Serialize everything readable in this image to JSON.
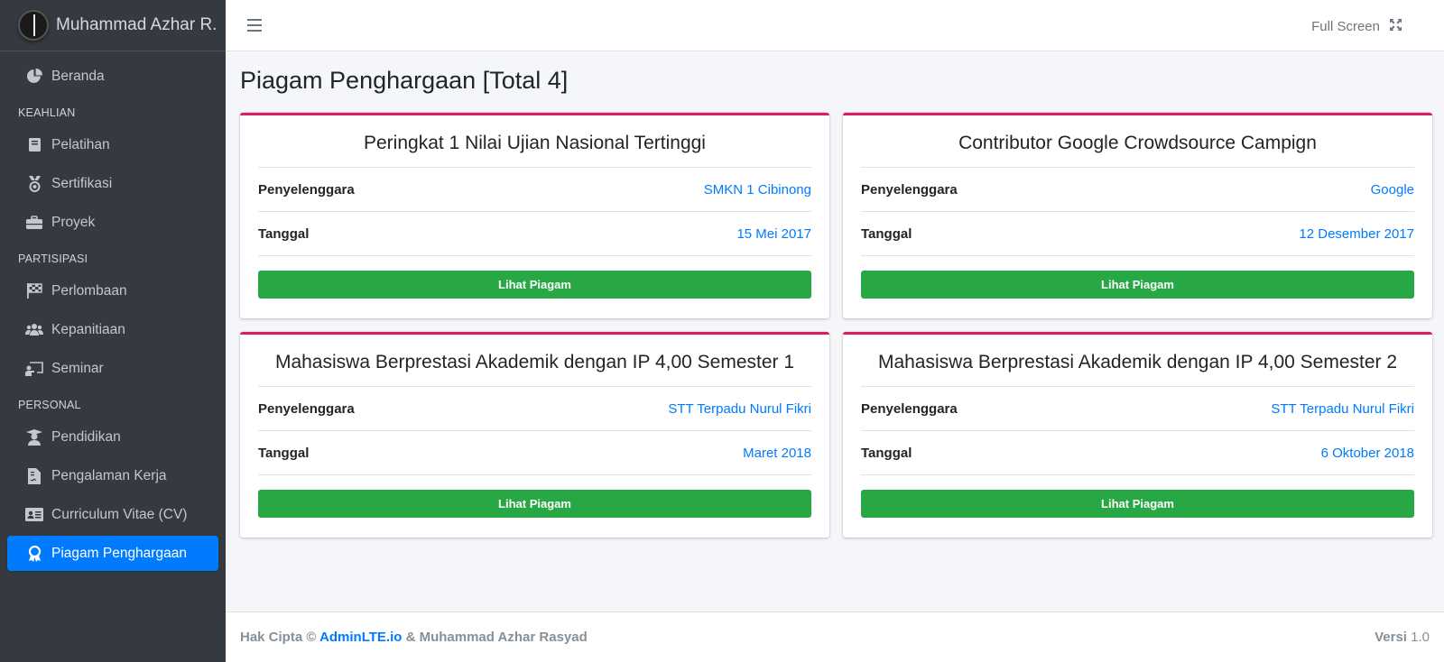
{
  "brand": {
    "name": "Muhammad Azhar R."
  },
  "sidebar": {
    "items": [
      {
        "label": "Beranda",
        "icon": "pie-chart-icon",
        "header_before": ""
      },
      {
        "label": "Pelatihan",
        "icon": "book-icon"
      },
      {
        "label": "Sertifikasi",
        "icon": "medal-icon"
      },
      {
        "label": "Proyek",
        "icon": "briefcase-icon"
      },
      {
        "label": "Perlombaan",
        "icon": "flag-checkered-icon"
      },
      {
        "label": "Kepanitiaan",
        "icon": "users-icon"
      },
      {
        "label": "Seminar",
        "icon": "chalkboard-teacher-icon"
      },
      {
        "label": "Pendidikan",
        "icon": "graduate-icon"
      },
      {
        "label": "Pengalaman Kerja",
        "icon": "file-contract-icon"
      },
      {
        "label": "Curriculum Vitae (CV)",
        "icon": "id-card-icon"
      },
      {
        "label": "Piagam Penghargaan",
        "icon": "award-icon",
        "active": true
      }
    ],
    "headers": {
      "keahlian": "KEAHLIAN",
      "partisipasi": "PARTISIPASI",
      "personal": "PERSONAL"
    }
  },
  "topbar": {
    "fullscreen_label": "Full Screen"
  },
  "page": {
    "title": "Piagam Penghargaan [Total 4]"
  },
  "cards": [
    {
      "title": "Peringkat 1 Nilai Ujian Nasional Tertinggi",
      "organizer_label": "Penyelenggara",
      "organizer": "SMKN 1 Cibinong",
      "date_label": "Tanggal",
      "date": "15 Mei 2017",
      "button": "Lihat Piagam"
    },
    {
      "title": "Contributor Google Crowdsource Campign",
      "organizer_label": "Penyelenggara",
      "organizer": "Google",
      "date_label": "Tanggal",
      "date": "12 Desember 2017",
      "button": "Lihat Piagam"
    },
    {
      "title": "Mahasiswa Berprestasi Akademik dengan IP 4,00 Semester 1",
      "organizer_label": "Penyelenggara",
      "organizer": "STT Terpadu Nurul Fikri",
      "date_label": "Tanggal",
      "date": "Maret 2018",
      "button": "Lihat Piagam"
    },
    {
      "title": "Mahasiswa Berprestasi Akademik dengan IP 4,00 Semester 2",
      "organizer_label": "Penyelenggara",
      "organizer": "STT Terpadu Nurul Fikri",
      "date_label": "Tanggal",
      "date": "6 Oktober 2018",
      "button": "Lihat Piagam"
    }
  ],
  "footer": {
    "prefix": "Hak Cipta ©",
    "link": "AdminLTE.io",
    "suffix": "& Muhammad Azhar Rasyad",
    "version_label": "Versi",
    "version": "1.0"
  },
  "colors": {
    "accent": "#007bff",
    "card_border": "#dc1e5c",
    "button": "#28a745",
    "sidebar_bg": "#343a40"
  }
}
